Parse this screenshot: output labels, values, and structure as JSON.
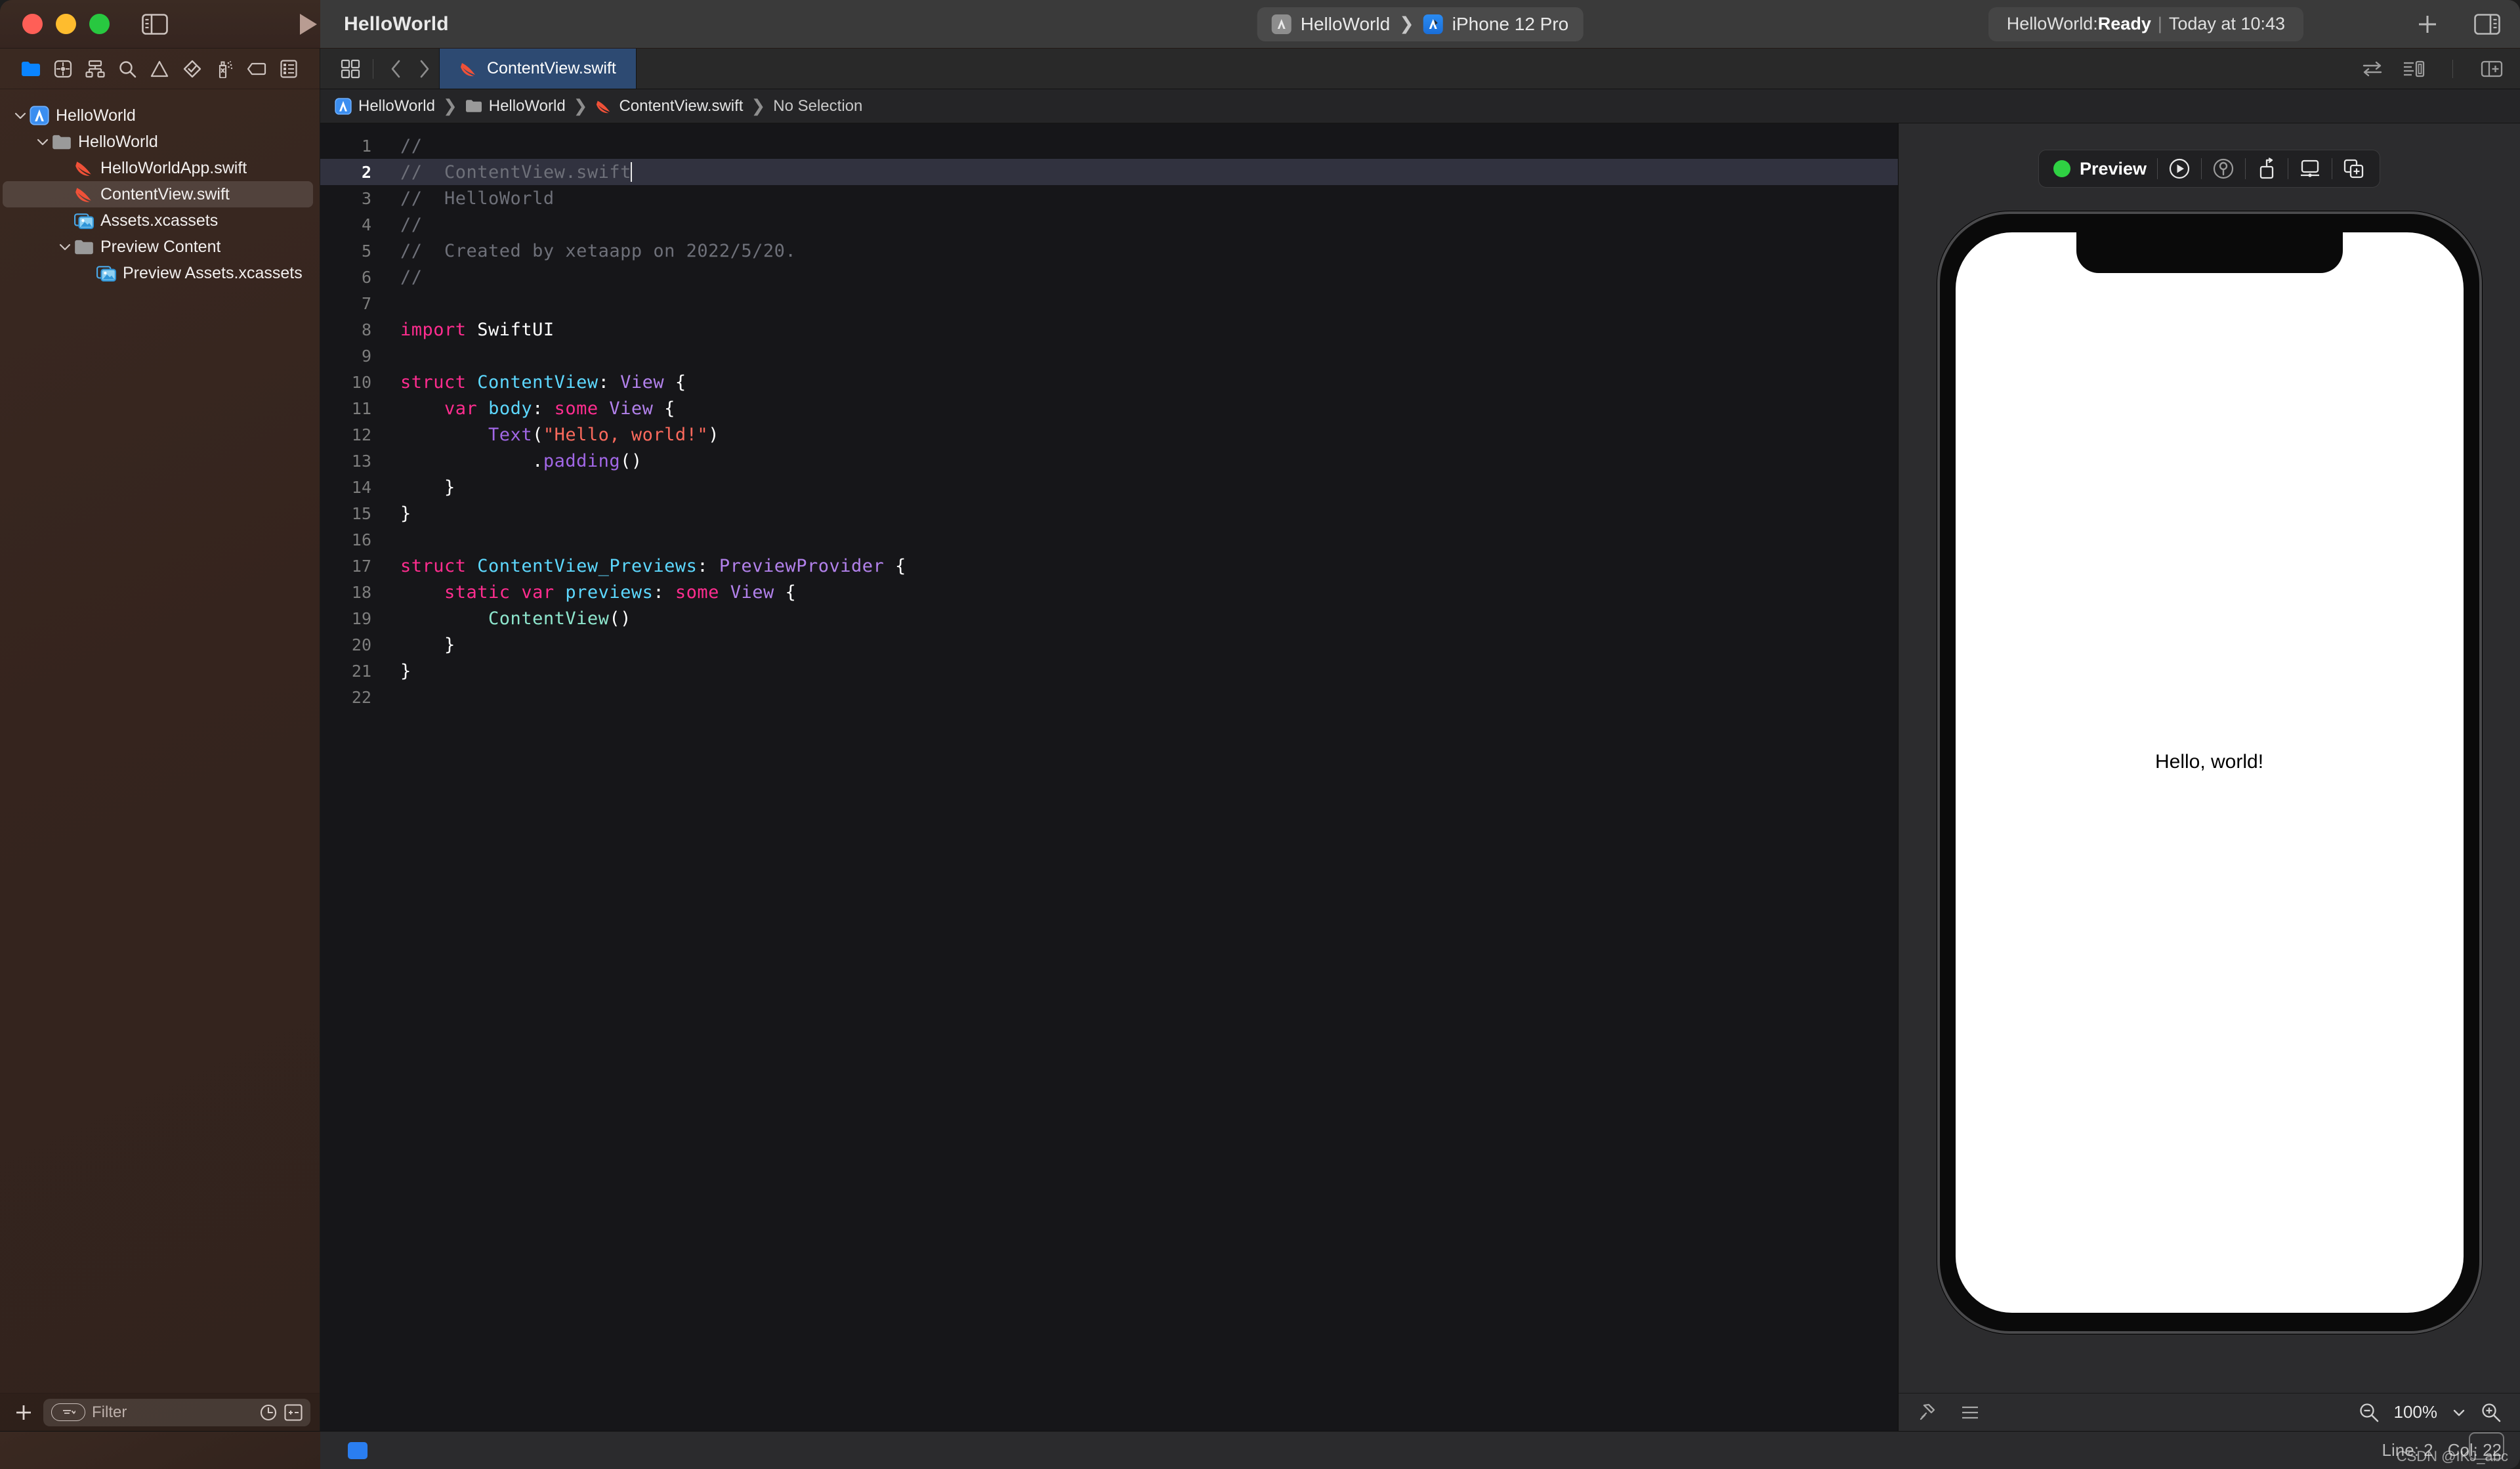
{
  "window": {
    "traffic_lights": [
      "close",
      "minimize",
      "zoom"
    ],
    "project_title": "HelloWorld"
  },
  "toolbar": {
    "sidebar_toggle": "sidebar-toggle-icon",
    "run_button": "run-icon",
    "scheme": {
      "project": "HelloWorld",
      "separator": "❯",
      "destination": "iPhone 12 Pro"
    },
    "activity": {
      "prefix": "HelloWorld: ",
      "state": "Ready",
      "divider": "|",
      "timestamp": "Today at 10:43"
    },
    "add_button": "plus-icon",
    "inspector_toggle": "inspector-toggle-icon"
  },
  "navigator": {
    "icons": [
      "folder-icon",
      "source-control-icon",
      "symbol-hierarchy-icon",
      "search-icon",
      "issue-warning-icon",
      "test-checkmark-icon",
      "debug-spray-icon",
      "breakpoint-tag-icon",
      "report-list-icon"
    ],
    "tree": [
      {
        "label": "HelloWorld",
        "icon": "xcode-project-icon",
        "indent": 0,
        "disclosure": "open",
        "selected": false
      },
      {
        "label": "HelloWorld",
        "icon": "folder-gray-icon",
        "indent": 1,
        "disclosure": "open",
        "selected": false
      },
      {
        "label": "HelloWorldApp.swift",
        "icon": "swift-file-icon",
        "indent": 2,
        "disclosure": "none",
        "selected": false
      },
      {
        "label": "ContentView.swift",
        "icon": "swift-file-icon",
        "indent": 2,
        "disclosure": "none",
        "selected": true
      },
      {
        "label": "Assets.xcassets",
        "icon": "xcassets-icon",
        "indent": 2,
        "disclosure": "none",
        "selected": false
      },
      {
        "label": "Preview Content",
        "icon": "folder-gray-icon",
        "indent": 2,
        "disclosure": "open",
        "selected": false
      },
      {
        "label": "Preview Assets.xcassets",
        "icon": "xcassets-icon",
        "indent": 3,
        "disclosure": "none",
        "selected": false
      }
    ],
    "filter": {
      "add_label": "+",
      "placeholder": "Filter",
      "recent_icon": "clock-icon",
      "scm_icon": "source-control-status-icon"
    }
  },
  "editor": {
    "tab": {
      "label": "ContentView.swift",
      "icon": "swift-file-icon"
    },
    "tab_controls": {
      "grid_icon": "tab-overview-icon",
      "back_icon": "chevron-left-icon",
      "forward_icon": "chevron-right-icon"
    },
    "right_controls": [
      "swap-editors-icon",
      "adjust-editor-options-icon",
      "add-editor-icon"
    ],
    "breadcrumb": [
      {
        "label": "HelloWorld",
        "icon": "xcode-project-icon"
      },
      {
        "label": "HelloWorld",
        "icon": "folder-gray-icon"
      },
      {
        "label": "ContentView.swift",
        "icon": "swift-file-icon"
      },
      {
        "label": "No Selection",
        "icon": "none"
      }
    ],
    "current_line": 2,
    "lines": [
      {
        "n": 1,
        "tokens": [
          {
            "t": "//",
            "c": "cm"
          }
        ]
      },
      {
        "n": 2,
        "tokens": [
          {
            "t": "//  ContentView.swift",
            "c": "cm"
          }
        ],
        "caret": true
      },
      {
        "n": 3,
        "tokens": [
          {
            "t": "//  HelloWorld",
            "c": "cm"
          }
        ]
      },
      {
        "n": 4,
        "tokens": [
          {
            "t": "//",
            "c": "cm"
          }
        ]
      },
      {
        "n": 5,
        "tokens": [
          {
            "t": "//  Created by xetaapp on 2022/5/20.",
            "c": "cm"
          }
        ]
      },
      {
        "n": 6,
        "tokens": [
          {
            "t": "//",
            "c": "cm"
          }
        ]
      },
      {
        "n": 7,
        "tokens": []
      },
      {
        "n": 8,
        "tokens": [
          {
            "t": "import ",
            "c": "kw"
          },
          {
            "t": "SwiftUI",
            "c": "pl"
          }
        ]
      },
      {
        "n": 9,
        "tokens": []
      },
      {
        "n": 10,
        "tokens": [
          {
            "t": "struct ",
            "c": "kw"
          },
          {
            "t": "ContentView",
            "c": "ty"
          },
          {
            "t": ": ",
            "c": "pl"
          },
          {
            "t": "View",
            "c": "pr"
          },
          {
            "t": " {",
            "c": "pl"
          }
        ]
      },
      {
        "n": 11,
        "tokens": [
          {
            "t": "    ",
            "c": "pl"
          },
          {
            "t": "var ",
            "c": "kw"
          },
          {
            "t": "body",
            "c": "ty"
          },
          {
            "t": ": ",
            "c": "pl"
          },
          {
            "t": "some ",
            "c": "kw"
          },
          {
            "t": "View",
            "c": "pr"
          },
          {
            "t": " {",
            "c": "pl"
          }
        ]
      },
      {
        "n": 12,
        "tokens": [
          {
            "t": "        ",
            "c": "pl"
          },
          {
            "t": "Text",
            "c": "mt"
          },
          {
            "t": "(",
            "c": "pl"
          },
          {
            "t": "\"Hello, world!\"",
            "c": "st"
          },
          {
            "t": ")",
            "c": "pl"
          }
        ]
      },
      {
        "n": 13,
        "tokens": [
          {
            "t": "            .",
            "c": "pl"
          },
          {
            "t": "padding",
            "c": "mt"
          },
          {
            "t": "()",
            "c": "pl"
          }
        ]
      },
      {
        "n": 14,
        "tokens": [
          {
            "t": "    }",
            "c": "pl"
          }
        ]
      },
      {
        "n": 15,
        "tokens": [
          {
            "t": "}",
            "c": "pl"
          }
        ]
      },
      {
        "n": 16,
        "tokens": []
      },
      {
        "n": 17,
        "tokens": [
          {
            "t": "struct ",
            "c": "kw"
          },
          {
            "t": "ContentView_Previews",
            "c": "ty"
          },
          {
            "t": ": ",
            "c": "pl"
          },
          {
            "t": "PreviewProvider",
            "c": "pr"
          },
          {
            "t": " {",
            "c": "pl"
          }
        ]
      },
      {
        "n": 18,
        "tokens": [
          {
            "t": "    ",
            "c": "pl"
          },
          {
            "t": "static var ",
            "c": "kw"
          },
          {
            "t": "previews",
            "c": "ty"
          },
          {
            "t": ": ",
            "c": "pl"
          },
          {
            "t": "some ",
            "c": "kw"
          },
          {
            "t": "View",
            "c": "pr"
          },
          {
            "t": " {",
            "c": "pl"
          }
        ]
      },
      {
        "n": 19,
        "tokens": [
          {
            "t": "        ",
            "c": "pl"
          },
          {
            "t": "ContentView",
            "c": "mint"
          },
          {
            "t": "()",
            "c": "pl"
          }
        ]
      },
      {
        "n": 20,
        "tokens": [
          {
            "t": "    }",
            "c": "pl"
          }
        ]
      },
      {
        "n": 21,
        "tokens": [
          {
            "t": "}",
            "c": "pl"
          }
        ]
      },
      {
        "n": 22,
        "tokens": []
      }
    ]
  },
  "preview": {
    "status_label": "Preview",
    "status_color": "#2fd143",
    "toolbar_icons": [
      "play-circle-icon",
      "inspect-preview-icon",
      "live-preview-device-icon",
      "preview-on-display-icon",
      "duplicate-preview-icon"
    ],
    "device": "iPhone 12 Pro",
    "screen_text": "Hello, world!",
    "bottom": {
      "pin_icon": "pin-icon",
      "list_icon": "preview-list-icon",
      "zoom_out_icon": "zoom-out-icon",
      "zoom_level": "100%",
      "zoom_chevron": "chevron-down-icon",
      "zoom_in_icon": "zoom-in-icon"
    }
  },
  "statusbar": {
    "line_label": "Line: 2",
    "col_label": "Col: 22",
    "watermark": "CSDN @IKJ_abc"
  }
}
